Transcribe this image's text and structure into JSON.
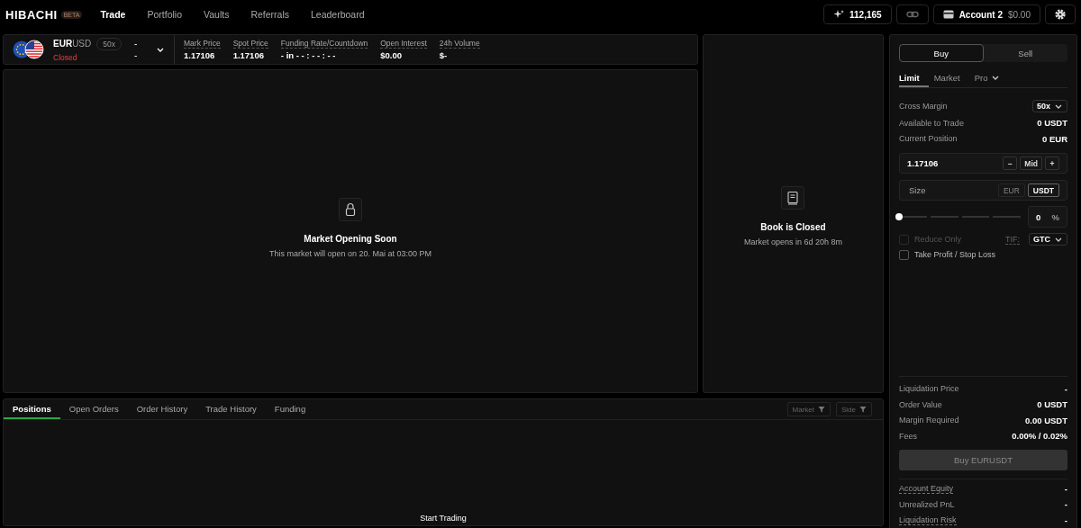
{
  "nav": {
    "logo": "HIBACHI",
    "badge": "BETA",
    "links": [
      {
        "label": "Trade",
        "selected": true
      },
      {
        "label": "Portfolio",
        "selected": false
      },
      {
        "label": "Vaults",
        "selected": false
      },
      {
        "label": "Referrals",
        "selected": false
      },
      {
        "label": "Leaderboard",
        "selected": false
      }
    ],
    "points": "112,165",
    "account": "Account 2",
    "balance": "$0.00"
  },
  "market": {
    "base": "EUR",
    "quote": "USD",
    "leverage": "50x",
    "status": "Closed",
    "bid": "-",
    "ask": "-",
    "stats": [
      {
        "label": "Mark Price",
        "value": "1.17106"
      },
      {
        "label": "Spot Price",
        "value": "1.17106"
      },
      {
        "label": "Funding Rate/Countdown",
        "value": "- in - - : - - : - -"
      },
      {
        "label": "Open Interest",
        "value": "$0.00"
      },
      {
        "label": "24h Volume",
        "value": "$-"
      }
    ]
  },
  "chart_panel": {
    "title": "Market Opening Soon",
    "message": "This market will open on 20. Mai at 03:00 PM"
  },
  "book": {
    "title": "Book is Closed",
    "message": "Market opens in 6d 20h 8m"
  },
  "bottom": {
    "tabs": [
      {
        "label": "Positions",
        "selected": true
      },
      {
        "label": "Open Orders",
        "selected": false
      },
      {
        "label": "Order History",
        "selected": false
      },
      {
        "label": "Trade History",
        "selected": false
      },
      {
        "label": "Funding",
        "selected": false
      }
    ],
    "filters": [
      "Market",
      "Side"
    ],
    "empty": "Start Trading"
  },
  "order": {
    "sides": [
      {
        "label": "Buy",
        "selected": true
      },
      {
        "label": "Sell",
        "selected": false
      }
    ],
    "types": [
      {
        "label": "Limit",
        "selected": true,
        "dropdown": false
      },
      {
        "label": "Market",
        "selected": false,
        "dropdown": false
      },
      {
        "label": "Pro",
        "selected": false,
        "dropdown": true
      }
    ],
    "margin_mode": "Cross Margin",
    "leverage": "50x",
    "info": [
      {
        "label": "Available to Trade",
        "value": "0 USDT"
      },
      {
        "label": "Current Position",
        "value": "0 EUR"
      }
    ],
    "price": "1.17106",
    "price_buttons": [
      "−",
      "Mid",
      "+"
    ],
    "size_placeholder": "Size",
    "units": [
      {
        "label": "EUR",
        "selected": false
      },
      {
        "label": "USDT",
        "selected": true
      }
    ],
    "slider": {
      "level": 0
    },
    "percent": "0",
    "percent_unit": "%",
    "options": [
      {
        "label": "Reduce Only",
        "checked": false,
        "disabled": true
      },
      {
        "label": "Take Profit / Stop Loss",
        "checked": false,
        "disabled": false
      }
    ],
    "tif_label": "TIF:",
    "tif": "GTC",
    "summary": [
      {
        "label": "Liquidation Price",
        "value": "-"
      },
      {
        "label": "Order Value",
        "value": "0 USDT"
      },
      {
        "label": "Margin Required",
        "value": "0.00 USDT"
      },
      {
        "label": "Fees",
        "value": "0.00% / 0.02%"
      }
    ],
    "submit": {
      "label": "Buy EURUSDT",
      "disabled": true
    },
    "account": [
      {
        "label": "Account Equity",
        "value": "-",
        "dotted": true
      },
      {
        "label": "Unrealized PnL",
        "value": "-",
        "dotted": false
      },
      {
        "label": "Liquidation Risk",
        "value": "-",
        "dotted": true
      }
    ]
  }
}
